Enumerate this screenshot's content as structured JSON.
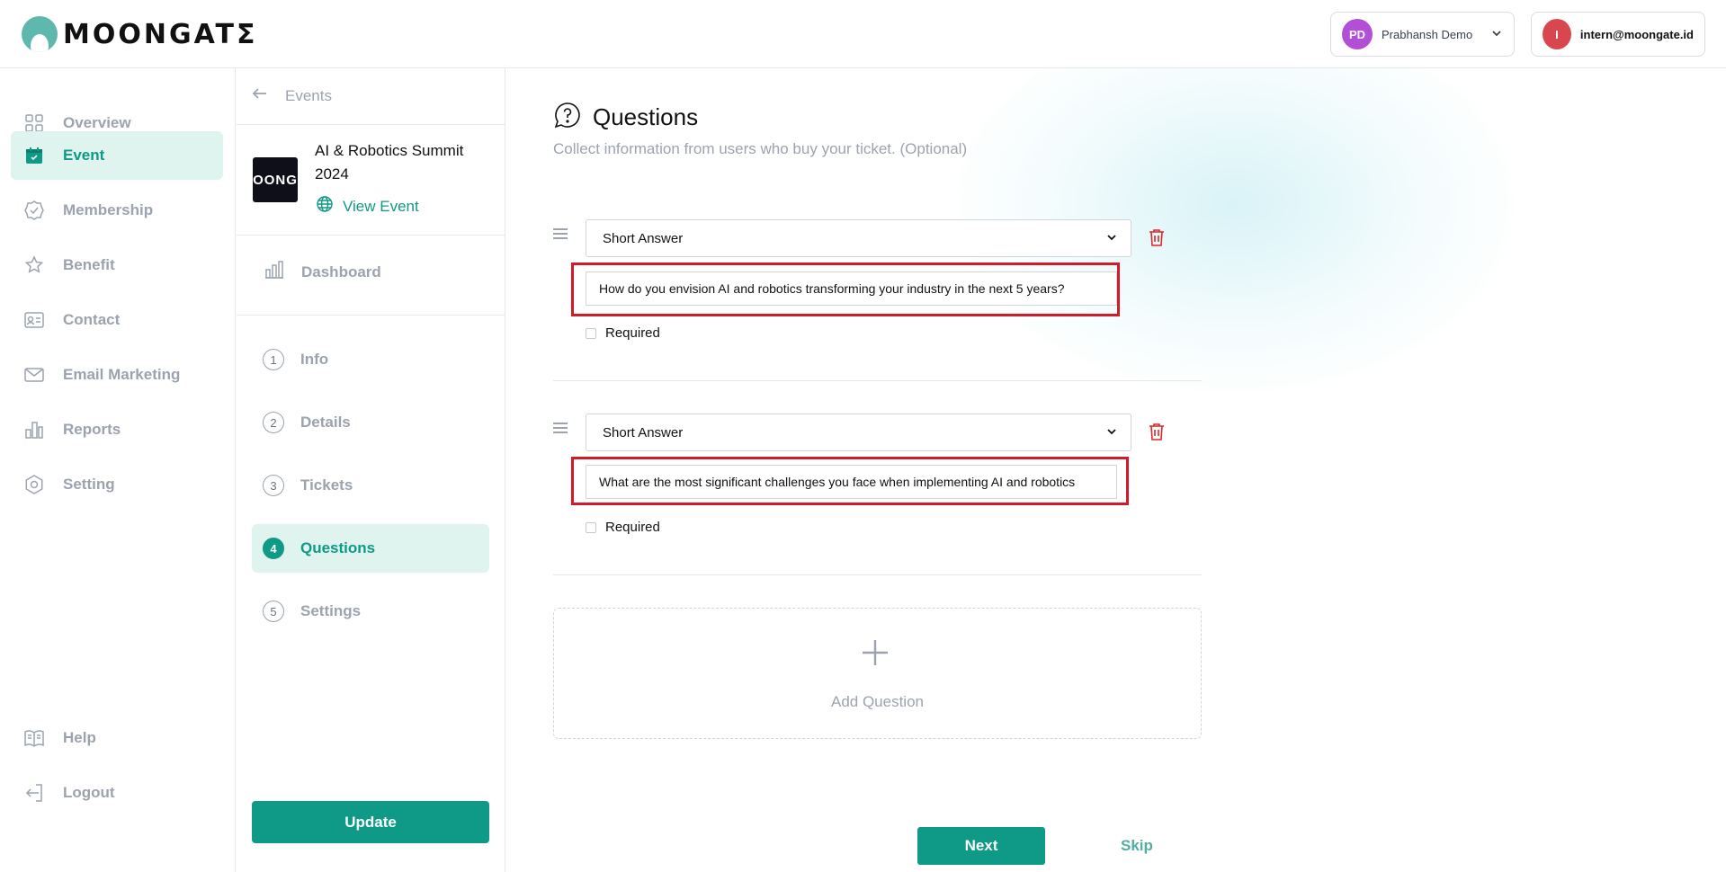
{
  "header": {
    "logo_text": "MOONGATƩ",
    "org": {
      "initials": "PD",
      "name": "Prabhansh Demo"
    },
    "user": {
      "initial": "I",
      "email": "intern@moongate.id"
    }
  },
  "sidebar": {
    "items": [
      {
        "label": "Overview",
        "icon": "grid-icon"
      },
      {
        "label": "Event",
        "icon": "calendar-icon",
        "active": true
      },
      {
        "label": "Membership",
        "icon": "badge-check-icon"
      },
      {
        "label": "Benefit",
        "icon": "star-icon"
      },
      {
        "label": "Contact",
        "icon": "contact-card-icon"
      },
      {
        "label": "Email Marketing",
        "icon": "mail-icon"
      },
      {
        "label": "Reports",
        "icon": "bar-chart-icon"
      },
      {
        "label": "Setting",
        "icon": "settings-icon"
      }
    ],
    "bottom": [
      {
        "label": "Help",
        "icon": "book-icon"
      },
      {
        "label": "Logout",
        "icon": "logout-icon"
      }
    ]
  },
  "event_panel": {
    "back_label": "Events",
    "thumb_text": "OONG",
    "event_title": "AI & Robotics Summit 2024",
    "view_event": "View Event",
    "dashboard": "Dashboard",
    "steps": [
      {
        "num": "1",
        "label": "Info"
      },
      {
        "num": "2",
        "label": "Details"
      },
      {
        "num": "3",
        "label": "Tickets"
      },
      {
        "num": "4",
        "label": "Questions",
        "active": true
      },
      {
        "num": "5",
        "label": "Settings"
      }
    ],
    "update_label": "Update"
  },
  "main": {
    "title": "Questions",
    "subtitle": "Collect information from users who buy your ticket. (Optional)",
    "questions": [
      {
        "type": "Short Answer",
        "text": "How do you envision AI and robotics transforming your industry in the next 5 years?",
        "required_label": "Required"
      },
      {
        "type": "Short Answer",
        "text": "What are the most significant challenges you face when implementing AI and robotics",
        "required_label": "Required"
      }
    ],
    "add_question": "Add Question",
    "next_label": "Next",
    "skip_label": "Skip"
  },
  "colors": {
    "brand": "#0e9a86",
    "active_bg": "#dff3ef",
    "highlight": "#d11a2a",
    "danger": "#dc2626"
  }
}
